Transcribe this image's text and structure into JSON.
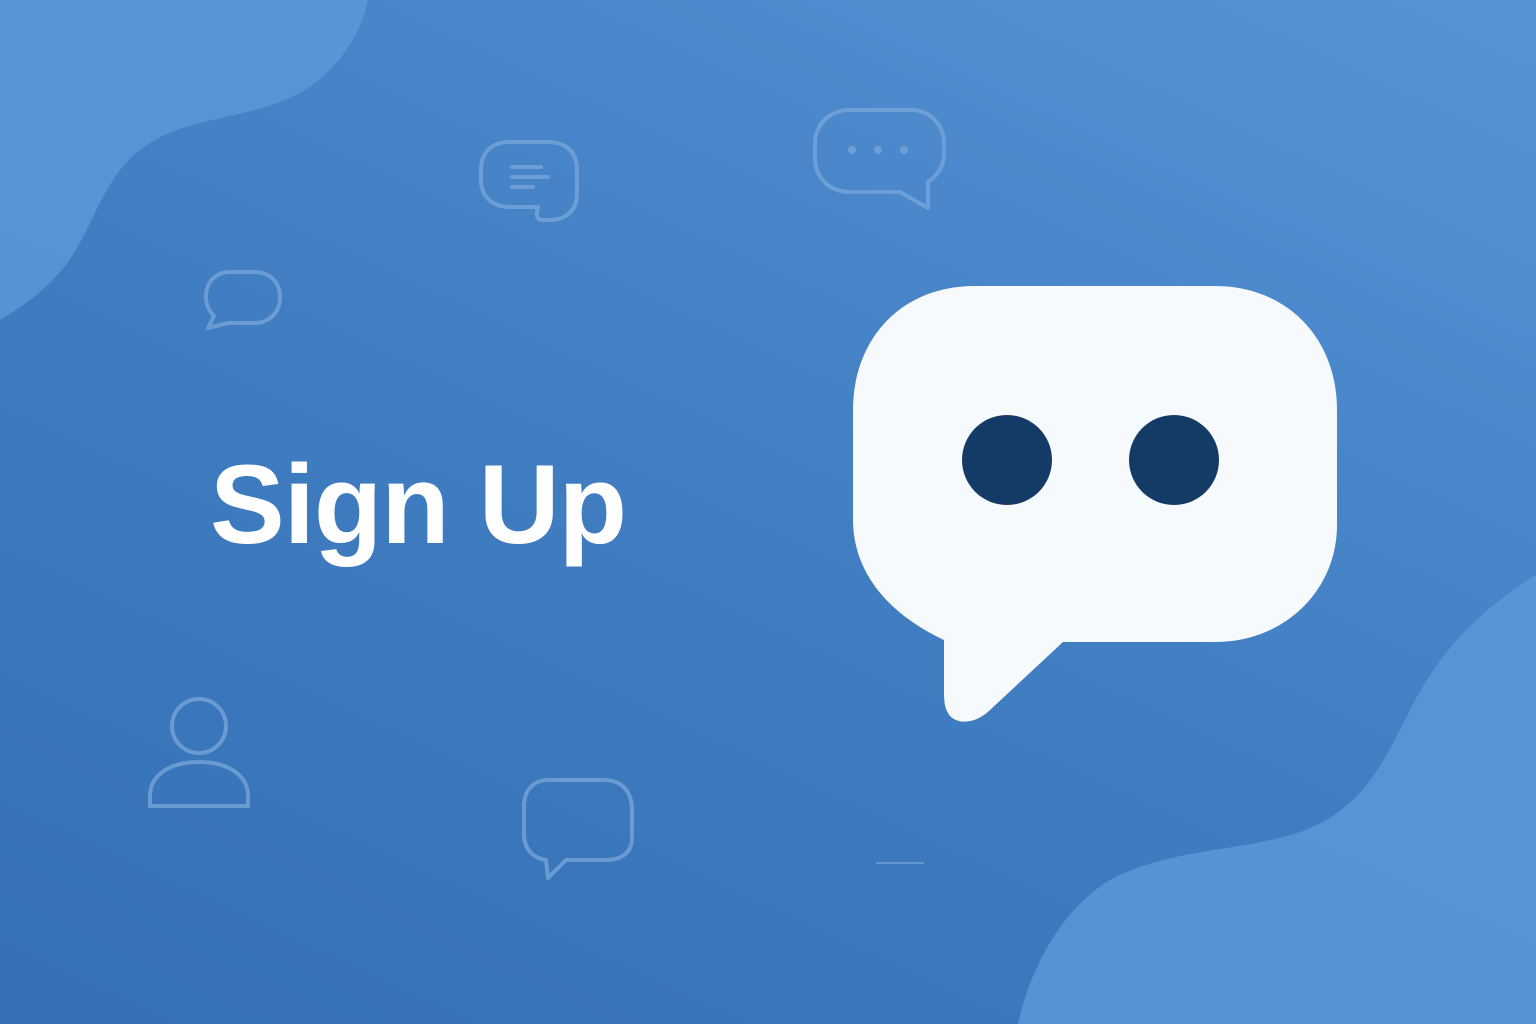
{
  "page": {
    "cta_label": "Sign Up"
  },
  "colors": {
    "background_dark": "#3570b5",
    "background_light": "#5594d3",
    "blob": "#5b98d6",
    "bubble_fill": "#f7fafd",
    "bubble_eyes": "#143a66",
    "outline_icons": "#7aa8dc",
    "text": "#ffffff"
  },
  "icons": {
    "logo": "chat-bubble-eyes-icon",
    "decorative": [
      "message-lines-icon",
      "message-dots-icon",
      "chat-bubble-icon",
      "user-icon",
      "chat-bubble-icon"
    ]
  }
}
